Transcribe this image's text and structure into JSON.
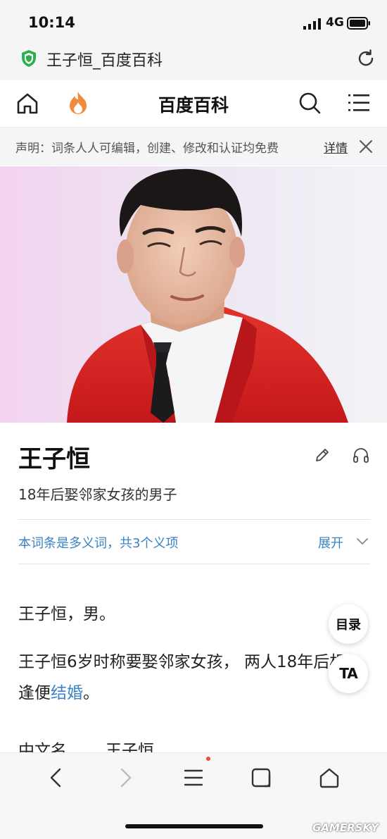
{
  "status_bar": {
    "time": "10:14",
    "network": "4G"
  },
  "url_bar": {
    "title": "王子恒_百度百科"
  },
  "nav": {
    "brand": "百度百科"
  },
  "notice": {
    "text": "声明：词条人人可编辑，创建、修改和认证均免费",
    "link": "详情"
  },
  "entry": {
    "title": "王子恒",
    "subtitle": "18年后娶邻家女孩的男子",
    "polysemy_text": "本词条是多义词，共3个义项",
    "expand_label": "展开",
    "para1": "王子恒，男。",
    "para2_text": "王子恒6岁时称要娶邻家女孩， 两人18年后相逢便",
    "para2_link": "结婚",
    "para2_end": "。",
    "info_label": "中文名",
    "info_value": "王子恒"
  },
  "floating": {
    "toc_label": "目录",
    "ta_label": "TA"
  },
  "watermark": "GAMERSKY",
  "colors": {
    "link": "#3b82c4",
    "flame": "#f08a3c",
    "shield": "#2bb24c",
    "jacket": "#d8221f"
  }
}
